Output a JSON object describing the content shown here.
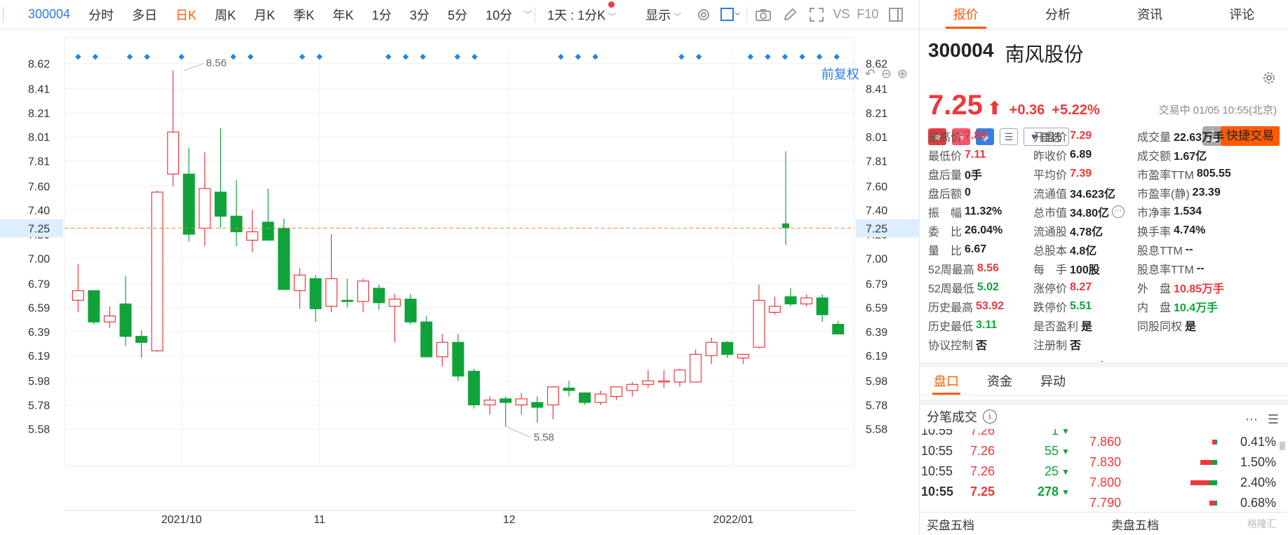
{
  "toolbar": {
    "code": "300004",
    "periods": [
      "分时",
      "多日",
      "日K",
      "周K",
      "月K",
      "季K",
      "年K",
      "1分",
      "3分",
      "5分",
      "10分"
    ],
    "active_period": "日K",
    "combo": "1天 : 1分K",
    "display": "显示",
    "vs": "VS",
    "f10": "F10"
  },
  "chart_controls": {
    "adjust": "前复权"
  },
  "chart_data": {
    "type": "candlestick",
    "y_ticks": [
      8.62,
      8.41,
      8.21,
      8.01,
      7.81,
      7.6,
      7.4,
      7.2,
      7.0,
      6.79,
      6.59,
      6.39,
      6.19,
      5.98,
      5.78,
      5.58
    ],
    "ylim": [
      5.4,
      8.75
    ],
    "x_labels": [
      {
        "label": "2021/10",
        "index": 6
      },
      {
        "label": "11",
        "index": 14
      },
      {
        "label": "12",
        "index": 25
      },
      {
        "label": "2022/01",
        "index": 38
      }
    ],
    "current_price": 7.25,
    "max_annotation": {
      "label": "8.56",
      "index": 3
    },
    "min_annotation": {
      "label": "5.58",
      "index": 13
    },
    "markers_at_index": [
      0,
      1,
      3,
      4,
      6,
      9,
      10,
      13,
      14,
      18,
      19,
      20,
      22,
      23,
      28,
      29,
      30,
      35,
      36,
      39,
      40,
      41,
      42,
      43,
      44
    ],
    "candles": [
      {
        "o": 6.65,
        "h": 6.95,
        "l": 6.55,
        "c": 6.73
      },
      {
        "o": 6.73,
        "h": 6.73,
        "l": 6.45,
        "c": 6.47
      },
      {
        "o": 6.47,
        "h": 6.6,
        "l": 6.42,
        "c": 6.52
      },
      {
        "o": 6.62,
        "h": 6.85,
        "l": 6.27,
        "c": 6.35
      },
      {
        "o": 6.35,
        "h": 6.4,
        "l": 6.17,
        "c": 6.3
      },
      {
        "o": 6.23,
        "h": 7.56,
        "l": 6.22,
        "c": 7.55
      },
      {
        "o": 7.7,
        "h": 8.56,
        "l": 7.6,
        "c": 8.05
      },
      {
        "o": 7.7,
        "h": 7.92,
        "l": 7.14,
        "c": 7.2
      },
      {
        "o": 7.25,
        "h": 7.88,
        "l": 7.1,
        "c": 7.58
      },
      {
        "o": 7.55,
        "h": 8.08,
        "l": 7.25,
        "c": 7.35
      },
      {
        "o": 7.35,
        "h": 7.65,
        "l": 7.1,
        "c": 7.22
      },
      {
        "o": 7.15,
        "h": 7.4,
        "l": 7.05,
        "c": 7.22
      },
      {
        "o": 7.3,
        "h": 7.58,
        "l": 7.2,
        "c": 7.15
      },
      {
        "o": 7.25,
        "h": 7.33,
        "l": 6.75,
        "c": 6.74
      },
      {
        "o": 6.73,
        "h": 6.92,
        "l": 6.58,
        "c": 6.86
      },
      {
        "o": 6.83,
        "h": 6.86,
        "l": 6.47,
        "c": 6.58
      },
      {
        "o": 6.6,
        "h": 7.2,
        "l": 6.55,
        "c": 6.83
      },
      {
        "o": 6.65,
        "h": 6.83,
        "l": 6.59,
        "c": 6.64
      },
      {
        "o": 6.64,
        "h": 6.83,
        "l": 6.55,
        "c": 6.81
      },
      {
        "o": 6.75,
        "h": 6.78,
        "l": 6.57,
        "c": 6.63
      },
      {
        "o": 6.6,
        "h": 6.7,
        "l": 6.3,
        "c": 6.66
      },
      {
        "o": 6.66,
        "h": 6.7,
        "l": 6.45,
        "c": 6.47
      },
      {
        "o": 6.47,
        "h": 6.52,
        "l": 6.19,
        "c": 6.18
      },
      {
        "o": 6.18,
        "h": 6.37,
        "l": 6.1,
        "c": 6.3
      },
      {
        "o": 6.3,
        "h": 6.37,
        "l": 5.98,
        "c": 6.02
      },
      {
        "o": 6.06,
        "h": 6.08,
        "l": 5.75,
        "c": 5.78
      },
      {
        "o": 5.78,
        "h": 5.85,
        "l": 5.7,
        "c": 5.82
      },
      {
        "o": 5.83,
        "h": 5.85,
        "l": 5.6,
        "c": 5.8
      },
      {
        "o": 5.78,
        "h": 5.88,
        "l": 5.7,
        "c": 5.83
      },
      {
        "o": 5.8,
        "h": 5.85,
        "l": 5.63,
        "c": 5.76
      },
      {
        "o": 5.78,
        "h": 5.93,
        "l": 5.66,
        "c": 5.93
      },
      {
        "o": 5.92,
        "h": 5.98,
        "l": 5.85,
        "c": 5.9
      },
      {
        "o": 5.88,
        "h": 5.88,
        "l": 5.78,
        "c": 5.8
      },
      {
        "o": 5.8,
        "h": 5.9,
        "l": 5.78,
        "c": 5.87
      },
      {
        "o": 5.85,
        "h": 5.93,
        "l": 5.82,
        "c": 5.93
      },
      {
        "o": 5.9,
        "h": 5.97,
        "l": 5.85,
        "c": 5.95
      },
      {
        "o": 5.95,
        "h": 6.07,
        "l": 5.92,
        "c": 5.98
      },
      {
        "o": 5.97,
        "h": 6.07,
        "l": 5.92,
        "c": 5.98
      },
      {
        "o": 5.97,
        "h": 6.08,
        "l": 5.93,
        "c": 6.07
      },
      {
        "o": 5.97,
        "h": 6.24,
        "l": 5.97,
        "c": 6.2
      },
      {
        "o": 6.19,
        "h": 6.34,
        "l": 6.12,
        "c": 6.3
      },
      {
        "o": 6.3,
        "h": 6.31,
        "l": 6.17,
        "c": 6.2
      },
      {
        "o": 6.17,
        "h": 6.2,
        "l": 6.12,
        "c": 6.2
      },
      {
        "o": 6.26,
        "h": 6.78,
        "l": 6.25,
        "c": 6.65
      },
      {
        "o": 6.55,
        "h": 6.68,
        "l": 6.53,
        "c": 6.6
      },
      {
        "o": 6.68,
        "h": 6.75,
        "l": 6.6,
        "c": 6.62
      },
      {
        "o": 6.62,
        "h": 6.7,
        "l": 6.6,
        "c": 6.67
      },
      {
        "o": 6.67,
        "h": 6.7,
        "l": 6.47,
        "c": 6.53
      },
      {
        "o": 6.45,
        "h": 6.48,
        "l": 6.37,
        "c": 6.37
      }
    ]
  },
  "quote": {
    "code": "300004",
    "name": "南风股份",
    "last": "7.25",
    "arrow": "⬆",
    "change": "+0.36",
    "change_pct": "+5.22%",
    "status": "交易中 01/05 10:55(北京)",
    "watch_label": "自选",
    "quick_trade": "快捷交易"
  },
  "right_tabs": [
    "报价",
    "分析",
    "资讯",
    "评论"
  ],
  "stats": [
    [
      {
        "label": "最高价",
        "value": "7.89",
        "color": "red"
      },
      {
        "label": "开盘价",
        "value": "7.29",
        "color": "red"
      },
      {
        "label": "成交量",
        "value": "22.63万手",
        "color": ""
      }
    ],
    [
      {
        "label": "最低价",
        "value": "7.11",
        "color": "red"
      },
      {
        "label": "昨收价",
        "value": "6.89",
        "color": ""
      },
      {
        "label": "成交额",
        "value": "1.67亿",
        "color": ""
      }
    ],
    [
      {
        "label": "盘后量",
        "value": "0手",
        "color": ""
      },
      {
        "label": "平均价",
        "value": "7.39",
        "color": "red"
      },
      {
        "label": "市盈率TTM",
        "value": "805.55",
        "color": ""
      }
    ],
    [
      {
        "label": "盘后额",
        "value": "0",
        "color": ""
      },
      {
        "label": "流通值",
        "value": "34.623亿",
        "color": ""
      },
      {
        "label": "市盈率(静)",
        "value": "23.39",
        "color": ""
      }
    ],
    [
      {
        "label": "振　幅",
        "value": "11.32%",
        "color": ""
      },
      {
        "label": "总市值",
        "value": "34.80亿",
        "color": ""
      },
      {
        "label": "市净率",
        "value": "1.534",
        "color": ""
      }
    ],
    [
      {
        "label": "委　比",
        "value": "26.04%",
        "color": ""
      },
      {
        "label": "流通股",
        "value": "4.78亿",
        "color": ""
      },
      {
        "label": "换手率",
        "value": "4.74%",
        "color": ""
      }
    ],
    [
      {
        "label": "量　比",
        "value": "6.67",
        "color": ""
      },
      {
        "label": "总股本",
        "value": "4.8亿",
        "color": ""
      },
      {
        "label": "股息TTM",
        "value": "--",
        "color": ""
      }
    ],
    [
      {
        "label": "52周最高",
        "value": "8.56",
        "color": "red"
      },
      {
        "label": "每　手",
        "value": "100股",
        "color": ""
      },
      {
        "label": "股息率TTM",
        "value": "--",
        "color": ""
      }
    ],
    [
      {
        "label": "52周最低",
        "value": "5.02",
        "color": "grn"
      },
      {
        "label": "涨停价",
        "value": "8.27",
        "color": "red"
      },
      {
        "label": "外　盘",
        "value": "10.85万手",
        "color": "red"
      }
    ],
    [
      {
        "label": "历史最高",
        "value": "53.92",
        "color": "red"
      },
      {
        "label": "跌停价",
        "value": "5.51",
        "color": "grn"
      },
      {
        "label": "内　盘",
        "value": "10.4万手",
        "color": "grn"
      }
    ],
    [
      {
        "label": "历史最低",
        "value": "3.11",
        "color": "grn"
      },
      {
        "label": "是否盈利",
        "value": "是",
        "color": ""
      },
      {
        "label": "同股同权",
        "value": "是",
        "color": ""
      }
    ],
    [
      {
        "label": "协议控制",
        "value": "否",
        "color": ""
      },
      {
        "label": "注册制",
        "value": "否",
        "color": ""
      },
      {
        "label": "",
        "value": "",
        "color": ""
      }
    ]
  ],
  "panel_tabs": [
    "盘口",
    "资金",
    "异动"
  ],
  "ticks_header": "分笔成交",
  "ticks": [
    {
      "time": "10:55",
      "price": "7.26",
      "vol": "1"
    },
    {
      "time": "10:55",
      "price": "7.26",
      "vol": "55"
    },
    {
      "time": "10:55",
      "price": "7.26",
      "vol": "25"
    },
    {
      "time": "10:55",
      "price": "7.25",
      "vol": "278"
    }
  ],
  "depth": [
    {
      "price": "7.860",
      "ratio": "0.41%",
      "pct": 0.41
    },
    {
      "price": "7.830",
      "ratio": "1.50%",
      "pct": 1.5
    },
    {
      "price": "7.800",
      "ratio": "2.40%",
      "pct": 2.4
    },
    {
      "price": "7.790",
      "ratio": "0.68%",
      "pct": 0.68
    }
  ],
  "bottom": {
    "buy5": "买盘五档",
    "sell5": "卖盘五档"
  },
  "watermark": "格隆汇"
}
